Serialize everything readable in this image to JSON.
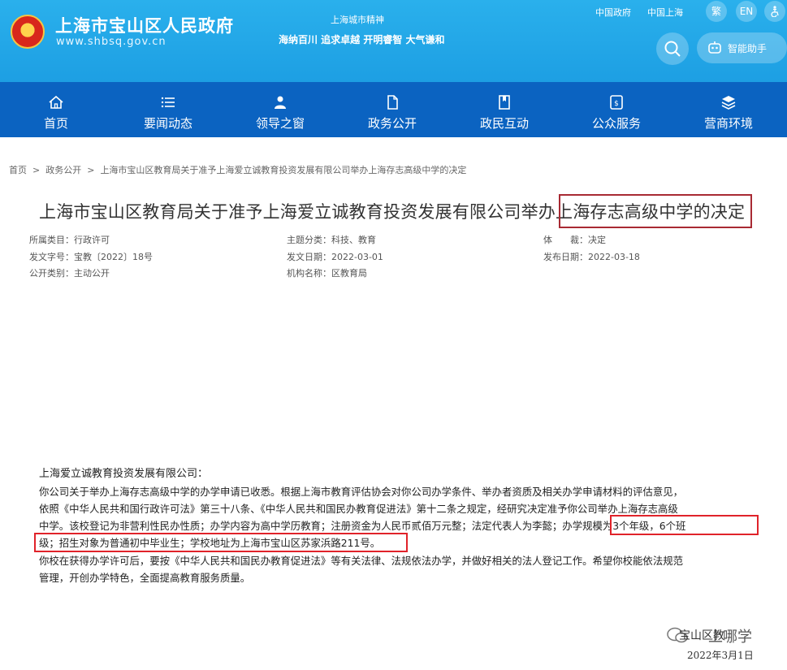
{
  "header": {
    "site_name": "上海市宝山区人民政府",
    "site_url": "www.shbsq.gov.cn",
    "spirit_title": "上海城市精神",
    "spirit_text": "海纳百川 追求卓越 开明睿智 大气谦和",
    "links": [
      "中国政府",
      "中国上海"
    ],
    "lang_trad": "繁",
    "lang_en": "EN",
    "assistant_label": "智能助手"
  },
  "nav": [
    {
      "label": "首页",
      "icon": "home-icon"
    },
    {
      "label": "要闻动态",
      "icon": "list-icon"
    },
    {
      "label": "领导之窗",
      "icon": "person-icon"
    },
    {
      "label": "政务公开",
      "icon": "document-icon"
    },
    {
      "label": "政民互动",
      "icon": "bookmark-icon"
    },
    {
      "label": "公众服务",
      "icon": "service-icon"
    },
    {
      "label": "营商环境",
      "icon": "layers-icon"
    }
  ],
  "breadcrumb": [
    "首页",
    "政务公开",
    "上海市宝山区教育局关于准予上海爱立诚教育投资发展有限公司举办上海存志高级中学的决定"
  ],
  "title": "上海市宝山区教育局关于准予上海爱立诚教育投资发展有限公司举办上海存志高级中学的决定",
  "meta": {
    "category_label": "所属类目：",
    "category": "行政许可",
    "topic_label": "主题分类：",
    "topic": "科技、教育",
    "genre_label": "体　　裁：",
    "genre": "决定",
    "doc_no_label": "发文字号：",
    "doc_no": "宝教〔2022〕18号",
    "issue_date_label": "发文日期：",
    "issue_date": "2022-03-01",
    "publish_date_label": "发布日期：",
    "publish_date": "2022-03-18",
    "disclosure_label": "公开类别：",
    "disclosure": "主动公开",
    "org_label": "机构名称：",
    "org": "区教育局"
  },
  "body": {
    "line1": "上海爱立诚教育投资发展有限公司：",
    "line2": "你公司关于举办上海存志高级中学的办学申请已收悉。根据上海市教育评估协会对你公司办学条件、举办者资质及相关办学申请材料的评估意见，",
    "line3": "依照《中华人民共和国行政许可法》第三十八条、《中华人民共和国民办教育促进法》第十二条之规定，经研究决定准予你公司举办上海存志高级",
    "line4": "中学。该校登记为非营利性民办性质；办学内容为高中学历教育；注册资金为人民币贰佰万元整；法定代表人为李懿；办学规模为3个年级，6个班",
    "line5": "级；招生对象为普通初中毕业生；学校地址为上海市宝山区苏家浜路211号。",
    "line6": "你校在获得办学许可后，要按《中华人民共和国民办教育促进法》等有关法律、法规依法办学，并做好相关的法人登记工作。希望你校能依法规范",
    "line7": "管理，开创办学特色，全面提高教育服务质量。"
  },
  "watermark": {
    "org": "宝山区教",
    "account": "上哪学",
    "date": "2022年3月1日"
  },
  "colors": {
    "header_bg": "#1d9fe3",
    "nav_bg": "#0b63c1",
    "title_box": "#a82a33",
    "highlight_box": "#e0232a"
  }
}
